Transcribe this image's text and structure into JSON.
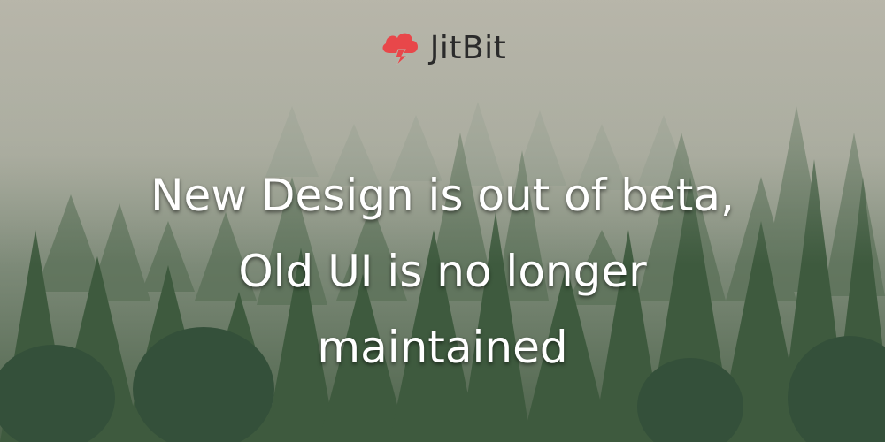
{
  "brand": {
    "name": "JitBit",
    "logo_icon": "cloud-lightning-icon",
    "logo_color": "#e8474a"
  },
  "headline": {
    "line1": "New Design is out of beta,",
    "line2": "Old UI is no longer",
    "line3": "maintained"
  },
  "background": {
    "description_icon": "forest-fog-background",
    "sky_color": "#b6b4a6",
    "forest_color": "#3d5a3e"
  }
}
